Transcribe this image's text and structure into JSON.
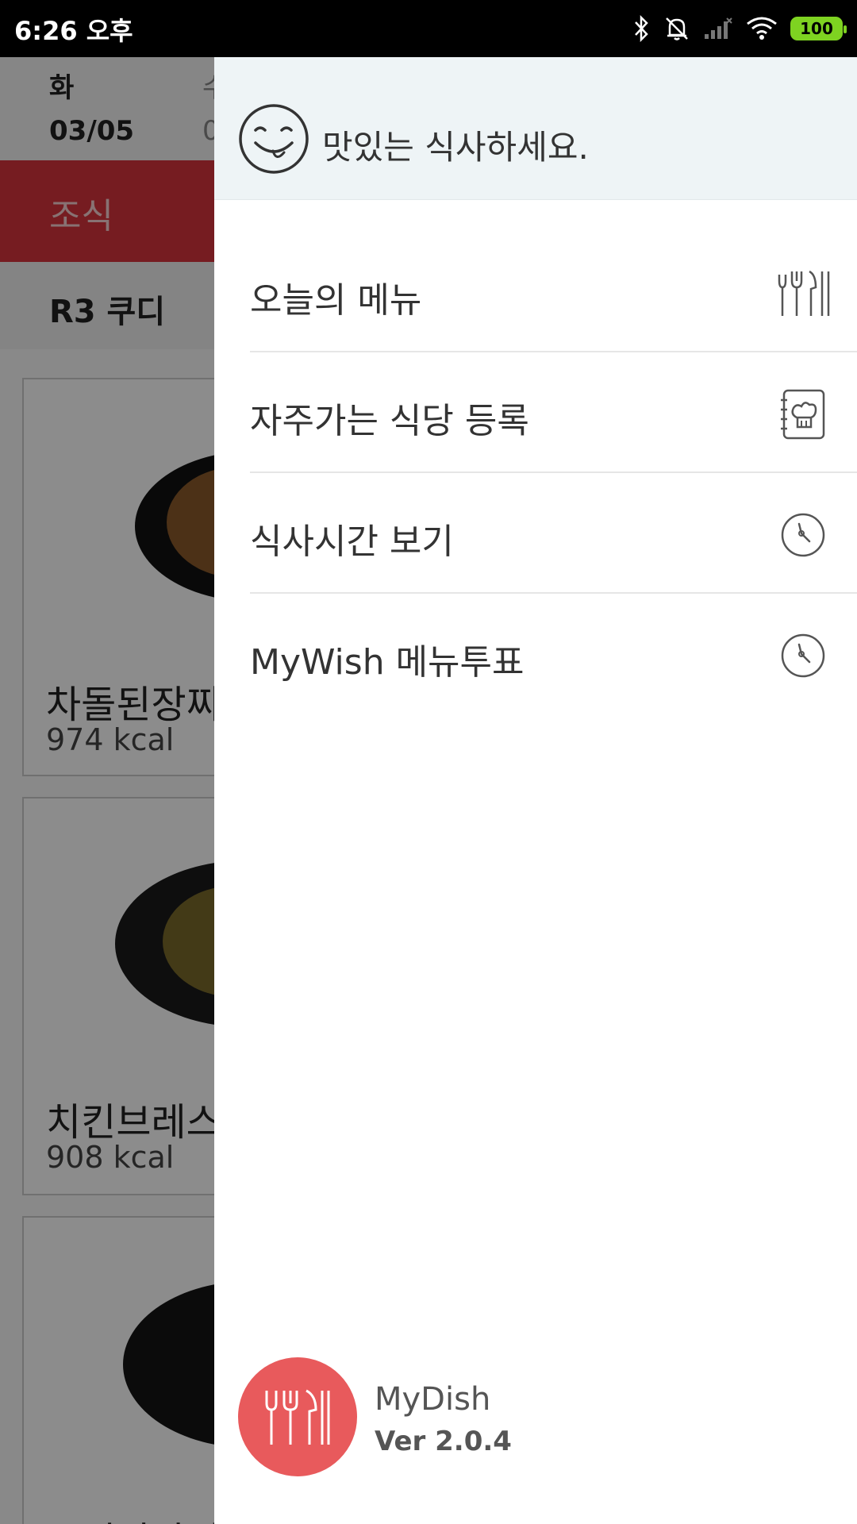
{
  "status_bar": {
    "time": "6:26 오후",
    "battery": "100",
    "icons": [
      "bluetooth-icon",
      "bell-off-icon",
      "signal-icon",
      "wifi-icon",
      "battery-icon"
    ],
    "battery_color": "#7ed321"
  },
  "background": {
    "day": "화",
    "date": "03/05",
    "next_day_partial": "수",
    "next_date_partial": "0",
    "meal_tab": "조식",
    "restaurant": "R3 쿠디",
    "foods": [
      {
        "name": "차돌된장찌개",
        "kcal": "974 kcal"
      },
      {
        "name": "치킨브레스트",
        "kcal": "908 kcal"
      },
      {
        "name": "유니짜장면",
        "kcal": ""
      }
    ],
    "accent_color": "#d8343d"
  },
  "drawer": {
    "greeting": "맛있는 식사하세요.",
    "menu": [
      {
        "label": "오늘의 메뉴",
        "icon": "cutlery-icon"
      },
      {
        "label": "자주가는 식당 등록",
        "icon": "chef-notebook-icon"
      },
      {
        "label": "식사시간 보기",
        "icon": "clock-icon"
      },
      {
        "label": "MyWish 메뉴투표",
        "icon": "clock-icon"
      }
    ],
    "app_name": "MyDish",
    "version": "Ver 2.0.4",
    "logo_color": "#e85a5c"
  }
}
